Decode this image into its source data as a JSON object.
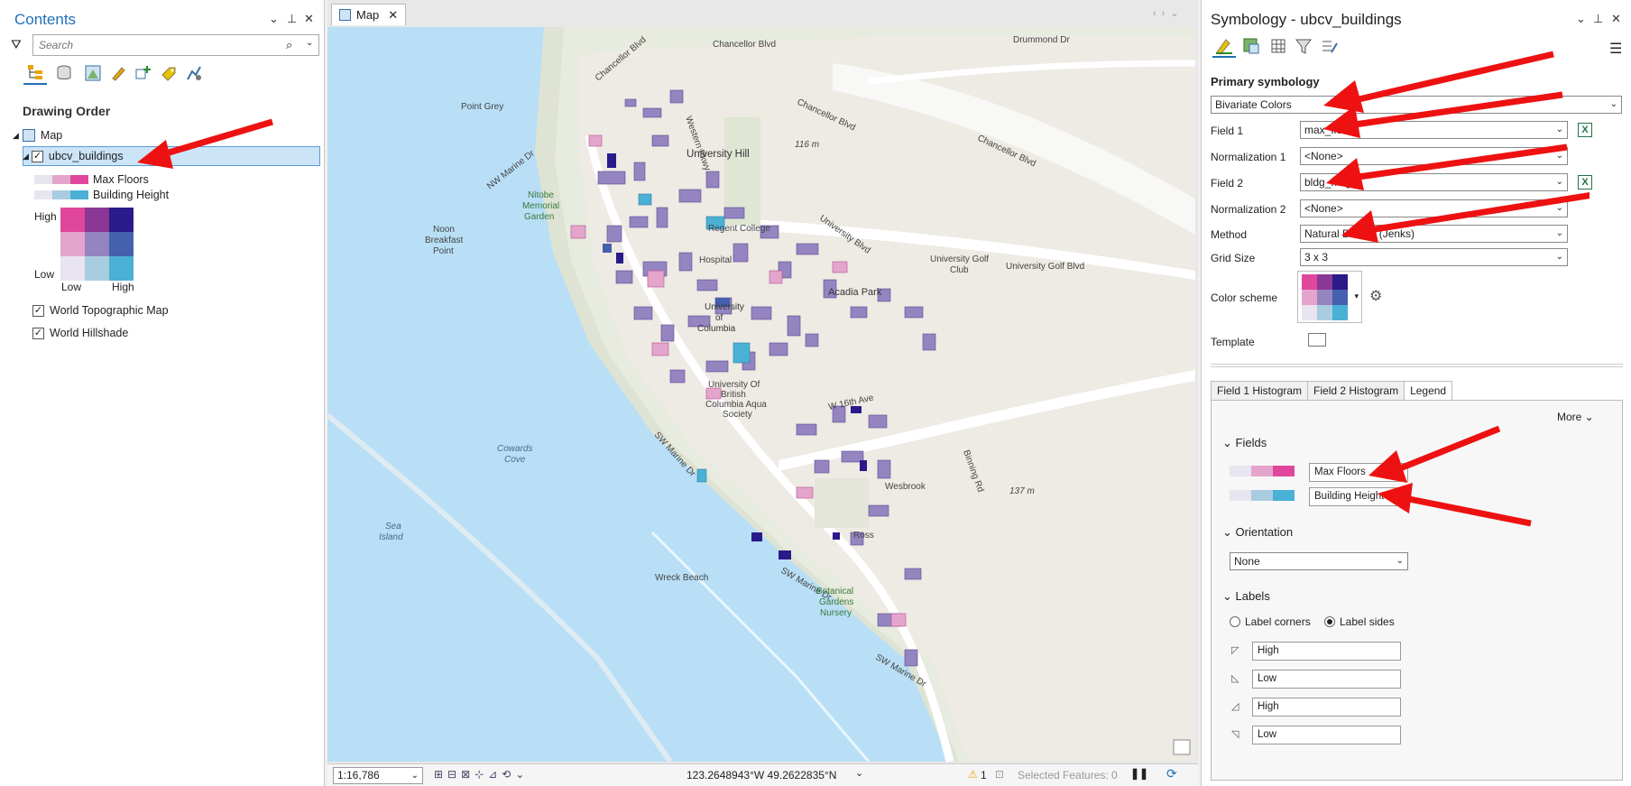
{
  "contents": {
    "title": "Contents",
    "search_placeholder": "Search",
    "drawing_order": "Drawing Order",
    "map_label": "Map",
    "layer_name": "ubcv_buildings",
    "legend_field1": "Max Floors",
    "legend_field2": "Building Height",
    "grid_high": "High",
    "grid_low_y": "Low",
    "grid_low_x": "Low",
    "grid_high_x": "High",
    "layer2": "World Topographic Map",
    "layer3": "World Hillshade"
  },
  "map": {
    "tab_label": "Map",
    "scale": "1:16,786",
    "coordinates": "123.2648943°W 49.2622835°N",
    "warning_count": "1",
    "selected_features": "Selected Features: 0",
    "places": {
      "chancellor_blvd_top": "Chancellor Blvd",
      "chancellor_blvd_diag": "Chancellor Blvd",
      "chancellor_blvd_right": "Chancellor Blvd",
      "chancellor_blvd_left": "Chancellor Blvd",
      "drummond": "Drummond Dr",
      "point_grey": "Point Grey",
      "nw_marine": "NW Marine Dr",
      "western_pkwy": "Western Pkwy",
      "university_hill": "University Hill",
      "elev116": "116 m",
      "nitobe1": "Nitobe",
      "nitobe2": "Memorial",
      "nitobe3": "Garden",
      "noon1": "Noon",
      "noon2": "Breakfast",
      "noon3": "Point",
      "regent": "Regent College",
      "hospital": "Hospital",
      "univ_blvd": "University Blvd",
      "golf1": "University Golf",
      "golf2": "Club",
      "golf_blvd": "University Golf Blvd",
      "acadia": "Acadia Park",
      "ubc1": "University",
      "ubc2": "of",
      "ubc3": "Columbia",
      "aqua1": "University Of",
      "aqua2": "British",
      "aqua3": "Columbia Aqua",
      "aqua4": "Society",
      "w16": "W 16th Ave",
      "sw_marine1": "SW Marine Dr",
      "sw_marine2": "SW Marine Dr",
      "sw_marine3": "SW Marine Dr",
      "cowards1": "Cowards",
      "cowards2": "Cove",
      "sea1": "Sea",
      "sea2": "Island",
      "wreck": "Wreck Beach",
      "botanical1": "Botanical",
      "botanical2": "Gardens",
      "botanical3": "Nursery",
      "elev137": "137 m",
      "binning": "Binning Rd",
      "ross": "Ross",
      "westbrook": "Wesbrook"
    }
  },
  "symbology": {
    "title": "Symbology - ubcv_buildings",
    "primary": "Primary symbology",
    "primary_value": "Bivariate Colors",
    "field1_label": "Field 1",
    "field1_value": "max_floors",
    "norm1_label": "Normalization 1",
    "norm1_value": "<None>",
    "field2_label": "Field 2",
    "field2_value": "bldg_height",
    "norm2_label": "Normalization 2",
    "norm2_value": "<None>",
    "method_label": "Method",
    "method_value": "Natural Breaks (Jenks)",
    "grid_label": "Grid Size",
    "grid_value": "3 x 3",
    "scheme_label": "Color scheme",
    "template_label": "Template",
    "tabs": [
      "Field 1 Histogram",
      "Field 2 Histogram",
      "Legend"
    ],
    "more": "More",
    "fields_section": "Fields",
    "field1_alias": "Max Floors",
    "field2_alias": "Building Height",
    "orientation_section": "Orientation",
    "orientation_value": "None",
    "labels_section": "Labels",
    "label_corners": "Label corners",
    "label_sides": "Label sides",
    "label_values": [
      "High",
      "Low",
      "High",
      "Low"
    ]
  },
  "colors": {
    "accent": "#1f6fb8",
    "water": "#b8dff6",
    "land": "#eeeae4",
    "arrow": "#ee1111",
    "bivariate": [
      "#e8e4f0",
      "#e4a5cc",
      "#e0479c",
      "#a9cde0",
      "#9484c0",
      "#8a3795",
      "#4ab0d6",
      "#4560ac",
      "#2a1a8a"
    ]
  }
}
